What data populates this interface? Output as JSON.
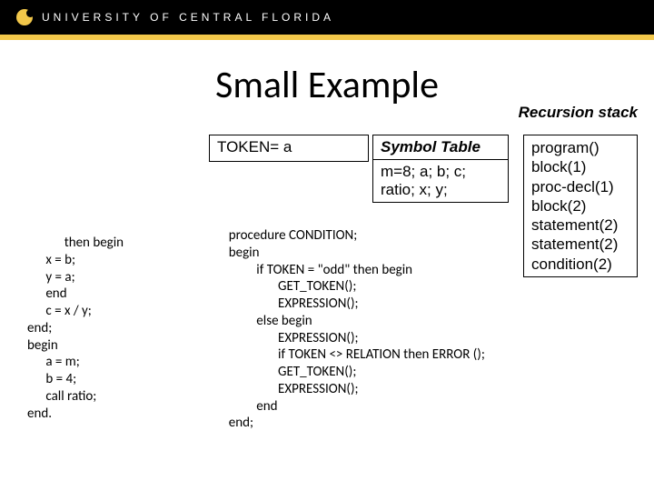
{
  "header": {
    "org": "UNIVERSITY OF CENTRAL FLORIDA"
  },
  "title": "Small Example",
  "recursion_label": "Recursion stack",
  "token_box": "TOKEN= a",
  "symbol_table": {
    "header": "Symbol Table",
    "body": "m=8; a; b; c; ratio; x; y;"
  },
  "stack": "program()\nblock(1)\nproc-decl(1)\nblock(2)\nstatement(2)\nstatement(2)\ncondition(2)",
  "left_code": "            then begin\n      x = b;\n      y = a;\n      end\n      c = x / y;\nend;\nbegin\n      a = m;\n      b = 4;\n      call ratio;\nend.",
  "right_code": "  procedure CONDITION;\n  begin\n           if TOKEN = \"odd\" then begin\n                  GET_TOKEN();\n                  EXPRESSION();\n           else begin\n                  EXPRESSION();\n                  if TOKEN <> RELATION then ERROR ();\n                  GET_TOKEN();\n                  EXPRESSION();\n           end\n  end;"
}
